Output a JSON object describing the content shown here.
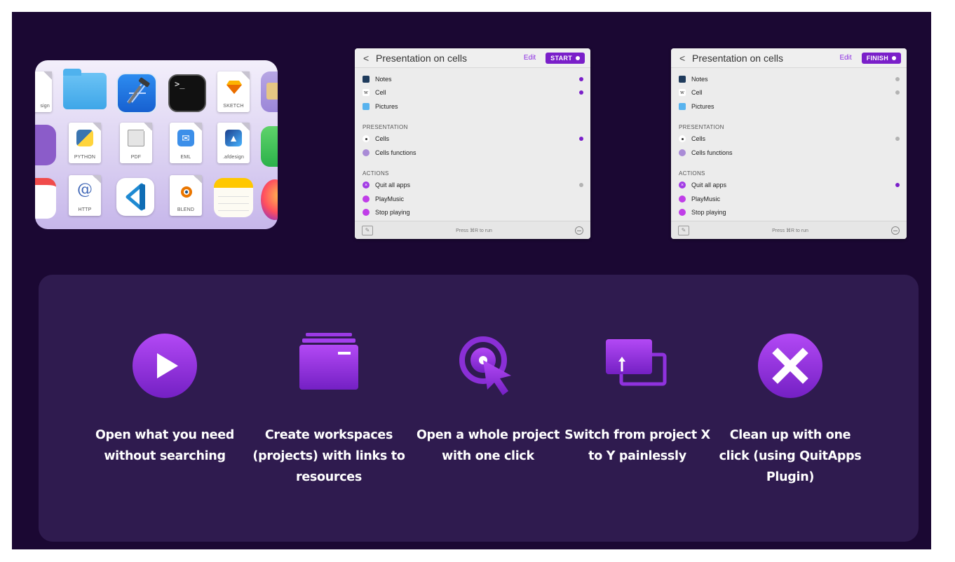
{
  "colors": {
    "accent": "#7a1fc9",
    "background": "#1b0833",
    "feature_bg": "#2f1b4f"
  },
  "icon_card": {
    "apps": [
      {
        "name": "design-doc",
        "label": "sign"
      },
      {
        "name": "folder",
        "label": ""
      },
      {
        "name": "xcode",
        "label": ""
      },
      {
        "name": "terminal",
        "label": ">_"
      },
      {
        "name": "sketch-doc",
        "label": "SKETCH"
      },
      {
        "name": "python-doc",
        "label": "PYTHON"
      },
      {
        "name": "pdf-doc",
        "label": "PDF"
      },
      {
        "name": "eml-doc",
        "label": "EML"
      },
      {
        "name": "afdesign-doc",
        "label": ".afdesign"
      },
      {
        "name": "http-doc",
        "label": "HTTP",
        "glyph": "@"
      },
      {
        "name": "vscode",
        "label": ""
      },
      {
        "name": "blend-doc",
        "label": "BLEND"
      },
      {
        "name": "notes",
        "label": ""
      }
    ]
  },
  "panels": [
    {
      "title": "Presentation on cells",
      "edit": "Edit",
      "button": "START",
      "items": [
        {
          "icon": "notes-icon",
          "label": "Notes",
          "state": "on"
        },
        {
          "icon": "wikipedia-icon",
          "label": "Cell",
          "state": "on"
        },
        {
          "icon": "folder-icon",
          "label": "Pictures",
          "state": "none"
        }
      ],
      "sections": [
        {
          "title": "PRESENTATION",
          "items": [
            {
              "icon": "keynote-icon",
              "label": "Cells",
              "state": "on"
            },
            {
              "icon": "script-icon",
              "label": "Cells functions",
              "state": "none"
            }
          ]
        },
        {
          "title": "ACTIONS",
          "items": [
            {
              "icon": "quit-icon",
              "label": "Quit all apps",
              "state": "off"
            },
            {
              "icon": "music-icon",
              "label": "PlayMusic",
              "state": "none"
            },
            {
              "icon": "stop-icon",
              "label": "Stop playing",
              "state": "none"
            }
          ]
        }
      ],
      "footer": "Press ⌘R to run"
    },
    {
      "title": "Presentation on cells",
      "edit": "Edit",
      "button": "FINISH",
      "items": [
        {
          "icon": "notes-icon",
          "label": "Notes",
          "state": "off"
        },
        {
          "icon": "wikipedia-icon",
          "label": "Cell",
          "state": "off"
        },
        {
          "icon": "folder-icon",
          "label": "Pictures",
          "state": "none"
        }
      ],
      "sections": [
        {
          "title": "PRESENTATION",
          "items": [
            {
              "icon": "keynote-icon",
              "label": "Cells",
              "state": "off"
            },
            {
              "icon": "script-icon",
              "label": "Cells functions",
              "state": "none"
            }
          ]
        },
        {
          "title": "ACTIONS",
          "items": [
            {
              "icon": "quit-icon",
              "label": "Quit all apps",
              "state": "on"
            },
            {
              "icon": "music-icon",
              "label": "PlayMusic",
              "state": "none"
            },
            {
              "icon": "stop-icon",
              "label": "Stop playing",
              "state": "none"
            }
          ]
        }
      ],
      "footer": "Press ⌘R to run"
    }
  ],
  "features": [
    {
      "icon": "play-icon",
      "caption": "Open what you need without searching"
    },
    {
      "icon": "workspaces-icon",
      "caption": "Create workspaces (projects) with links to resources"
    },
    {
      "icon": "click-cursor-icon",
      "caption": "Open a whole project with one click"
    },
    {
      "icon": "switch-windows-icon",
      "caption": "Switch from project X to Y painlessly"
    },
    {
      "icon": "close-x-icon",
      "caption": "Clean up with one click (using QuitApps Plugin)"
    }
  ]
}
